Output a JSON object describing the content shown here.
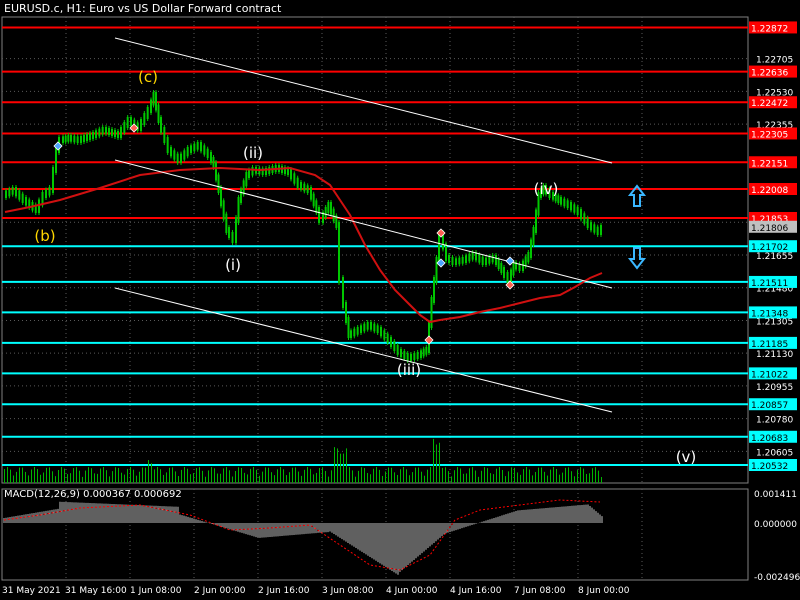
{
  "title": "EURUSD.c, H1:  Euro vs US Dollar Forward contract",
  "macd_label": "MACD(12,26,9) 0.000367 0.000692",
  "colors": {
    "background": "#000000",
    "grid": "#5a5a5a",
    "bull_candle": "#00c800",
    "bear_candle": "#00c800",
    "red_level": "#ff0000",
    "cyan_level": "#00ffff",
    "ma": "#d01010",
    "channel": "#ffffff",
    "wave_label_yellow": "#ffd700",
    "wave_label_white": "#ffffff",
    "volume": "#00b400",
    "macd_hist": "#c0c0c0",
    "macd_signal": "#ff0000"
  },
  "price_axis_labels": [
    "1.22705",
    "1.22530",
    "1.22355",
    "1.21830",
    "1.21655",
    "1.21480",
    "1.21305",
    "1.21130",
    "1.20955",
    "1.20780",
    "1.20605"
  ],
  "level_lines": [
    {
      "value": "1.22872",
      "color": "red"
    },
    {
      "value": "1.22636",
      "color": "red"
    },
    {
      "value": "1.22472",
      "color": "red"
    },
    {
      "value": "1.22305",
      "color": "red"
    },
    {
      "value": "1.22151",
      "color": "red"
    },
    {
      "value": "1.22008",
      "color": "red"
    },
    {
      "value": "1.21853",
      "color": "red"
    },
    {
      "value": "1.21806",
      "color": "current"
    },
    {
      "value": "1.21702",
      "color": "cyan"
    },
    {
      "value": "1.21511",
      "color": "cyan"
    },
    {
      "value": "1.21348",
      "color": "cyan"
    },
    {
      "value": "1.21185",
      "color": "cyan"
    },
    {
      "value": "1.21022",
      "color": "cyan"
    },
    {
      "value": "1.20857",
      "color": "cyan"
    },
    {
      "value": "1.20683",
      "color": "cyan"
    },
    {
      "value": "1.20532",
      "color": "cyan"
    }
  ],
  "wave_labels": [
    {
      "text": "(c)",
      "color": "yellow"
    },
    {
      "text": "(b)",
      "color": "yellow"
    },
    {
      "text": "(ii)",
      "color": "white"
    },
    {
      "text": "(i)",
      "color": "white"
    },
    {
      "text": "(iv)",
      "color": "white"
    },
    {
      "text": "(iii)",
      "color": "white"
    },
    {
      "text": "(v)",
      "color": "white"
    }
  ],
  "macd_axis_labels": [
    "0.001411",
    "0.000000",
    "-0.002496"
  ],
  "time_axis_labels": [
    "31 May 2021",
    "31 May 16:00",
    "1 Jun 08:00",
    "2 Jun 00:00",
    "2 Jun 16:00",
    "3 Jun 08:00",
    "4 Jun 00:00",
    "4 Jun 16:00",
    "7 Jun 08:00",
    "8 Jun 00:00"
  ],
  "icons": {
    "up_arrow": "up-arrow-icon",
    "down_arrow": "down-arrow-icon"
  }
}
